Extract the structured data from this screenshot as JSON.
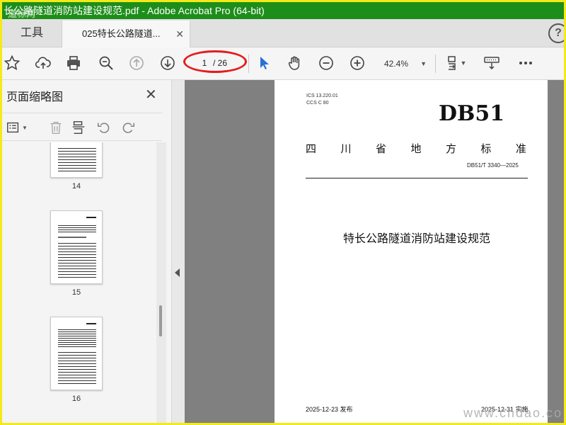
{
  "window": {
    "title": "长公路隧道消防站建设规范.pdf - Adobe Acrobat Pro (64-bit)",
    "accent_color": "#1e8e1a"
  },
  "tabs": {
    "tools_label": "工具",
    "document_label": "025特长公路隧道...",
    "close_glyph": "✕"
  },
  "toolbar": {
    "current_page": "1",
    "total_pages": "/ 26",
    "zoom": "42.4%",
    "icons": [
      "star-icon",
      "upload-icon",
      "print-icon",
      "search-zoom-icon",
      "page-up-icon",
      "page-down-icon",
      "select-cursor-icon",
      "hand-icon",
      "zoom-out-icon",
      "zoom-in-icon",
      "page-display-icon",
      "keyboard-icon",
      "more-icon"
    ]
  },
  "left_pane": {
    "title": "页面缩略图",
    "thumbnails": [
      {
        "label": "14"
      },
      {
        "label": "15"
      },
      {
        "label": "16"
      }
    ]
  },
  "document_page": {
    "ics_line1": "ICS  13.220.01",
    "ics_line2": "CCS  C 80",
    "standard_code": "DB51",
    "province_chars": [
      "四",
      "川",
      "省",
      "地",
      "方",
      "标",
      "准"
    ],
    "standard_number": "DB51/T 3340—2025",
    "title": "特长公路隧道消防站建设规范",
    "publish_date": "2025-12-23 发布",
    "implement_date": "2025-12-31 实施"
  },
  "watermarks": {
    "top_left": "道标网",
    "bottom_right": "www.chdao.co"
  }
}
